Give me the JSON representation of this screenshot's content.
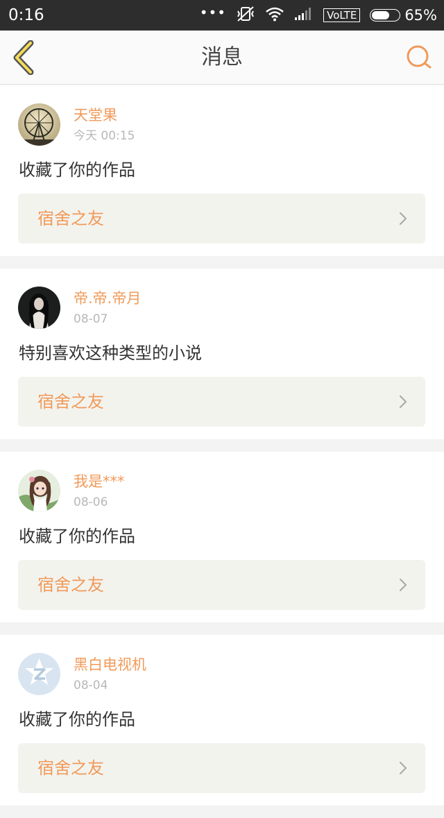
{
  "status_bar": {
    "time": "0:16",
    "dots": "•••",
    "network": "VoLTE",
    "battery_percent": "65%",
    "battery_level": 0.65
  },
  "nav": {
    "title": "消息",
    "back_icon": "chevron-left-icon",
    "search_icon": "search-icon",
    "accent_color": "#f09a5a"
  },
  "messages": [
    {
      "user": "天堂果",
      "time": "今天 00:15",
      "text": "收藏了你的作品",
      "work_title": "宿舍之友"
    },
    {
      "user": "帝.帝.帝月",
      "time": "08-07",
      "text": "特别喜欢这种类型的小说",
      "work_title": "宿舍之友"
    },
    {
      "user": "我是***",
      "time": "08-06",
      "text": "收藏了你的作品",
      "work_title": "宿舍之友"
    },
    {
      "user": "黑白电视机",
      "time": "08-04",
      "text": "收藏了你的作品",
      "work_title": "宿舍之友"
    }
  ]
}
